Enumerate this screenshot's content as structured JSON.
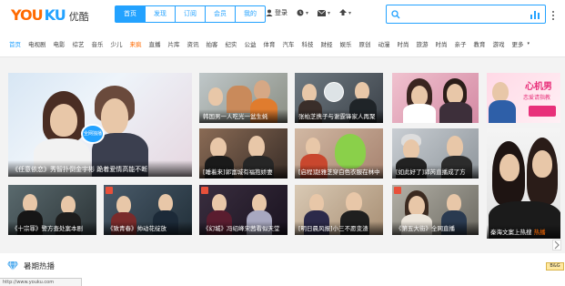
{
  "logo": {
    "you": "YOU",
    "ku": "KU",
    "cn": "优酷"
  },
  "nav_tabs": [
    "首页",
    "发现",
    "订阅",
    "会员",
    "我的"
  ],
  "user_tools": {
    "login": "登录"
  },
  "search": {
    "placeholder": ""
  },
  "categories": [
    "首页",
    "电视剧",
    "电影",
    "综艺",
    "音乐",
    "少儿",
    "来疯",
    "直播",
    "片库",
    "资讯",
    "拍客",
    "纪实",
    "公益",
    "体育",
    "汽车",
    "科技",
    "财经",
    "娱乐",
    "原创",
    "动漫",
    "时尚",
    "旅游",
    "时尚",
    "亲子",
    "教育",
    "游戏",
    "更多"
  ],
  "tiles": {
    "hero_caption": "《任意依恋》秀智扑倒金宇彬 跪着爱情高能不断",
    "hero_badge": "全网独播",
    "r1c2": "韩国男一人吃光一盆生蚝",
    "r1c3": "张柏芝携子与谢霆锋家人再聚",
    "r2c2": "[睡着来]郭富城有福抱娇妻",
    "r2c3": "[启程]赵雅芝穿白色衣服在林中",
    "r2c4": "[如此好了]郭芮直播成了方",
    "r2c5": "",
    "r3c1": "《十宗罪》警方查处案本剧",
    "r3c2": "《致青春》帅动花绽放",
    "r3c3": "《幻城》冯绍峰宋茜看似天堂",
    "r3c4": "[明日晨风报]小三不愿变渣",
    "r3c5": "《第五大街》全网直播",
    "right_banner_title": "心机男",
    "right_banner_sub": "恋爱请指教",
    "right_caption": "秦海文案上热搜",
    "right_caption_hot": "热播"
  },
  "section": {
    "title": "暑期热播"
  },
  "statusbar": {
    "text": "http://www.youku.com"
  },
  "colors": {
    "accent": "#23a2ff",
    "orange": "#ff6a00"
  }
}
